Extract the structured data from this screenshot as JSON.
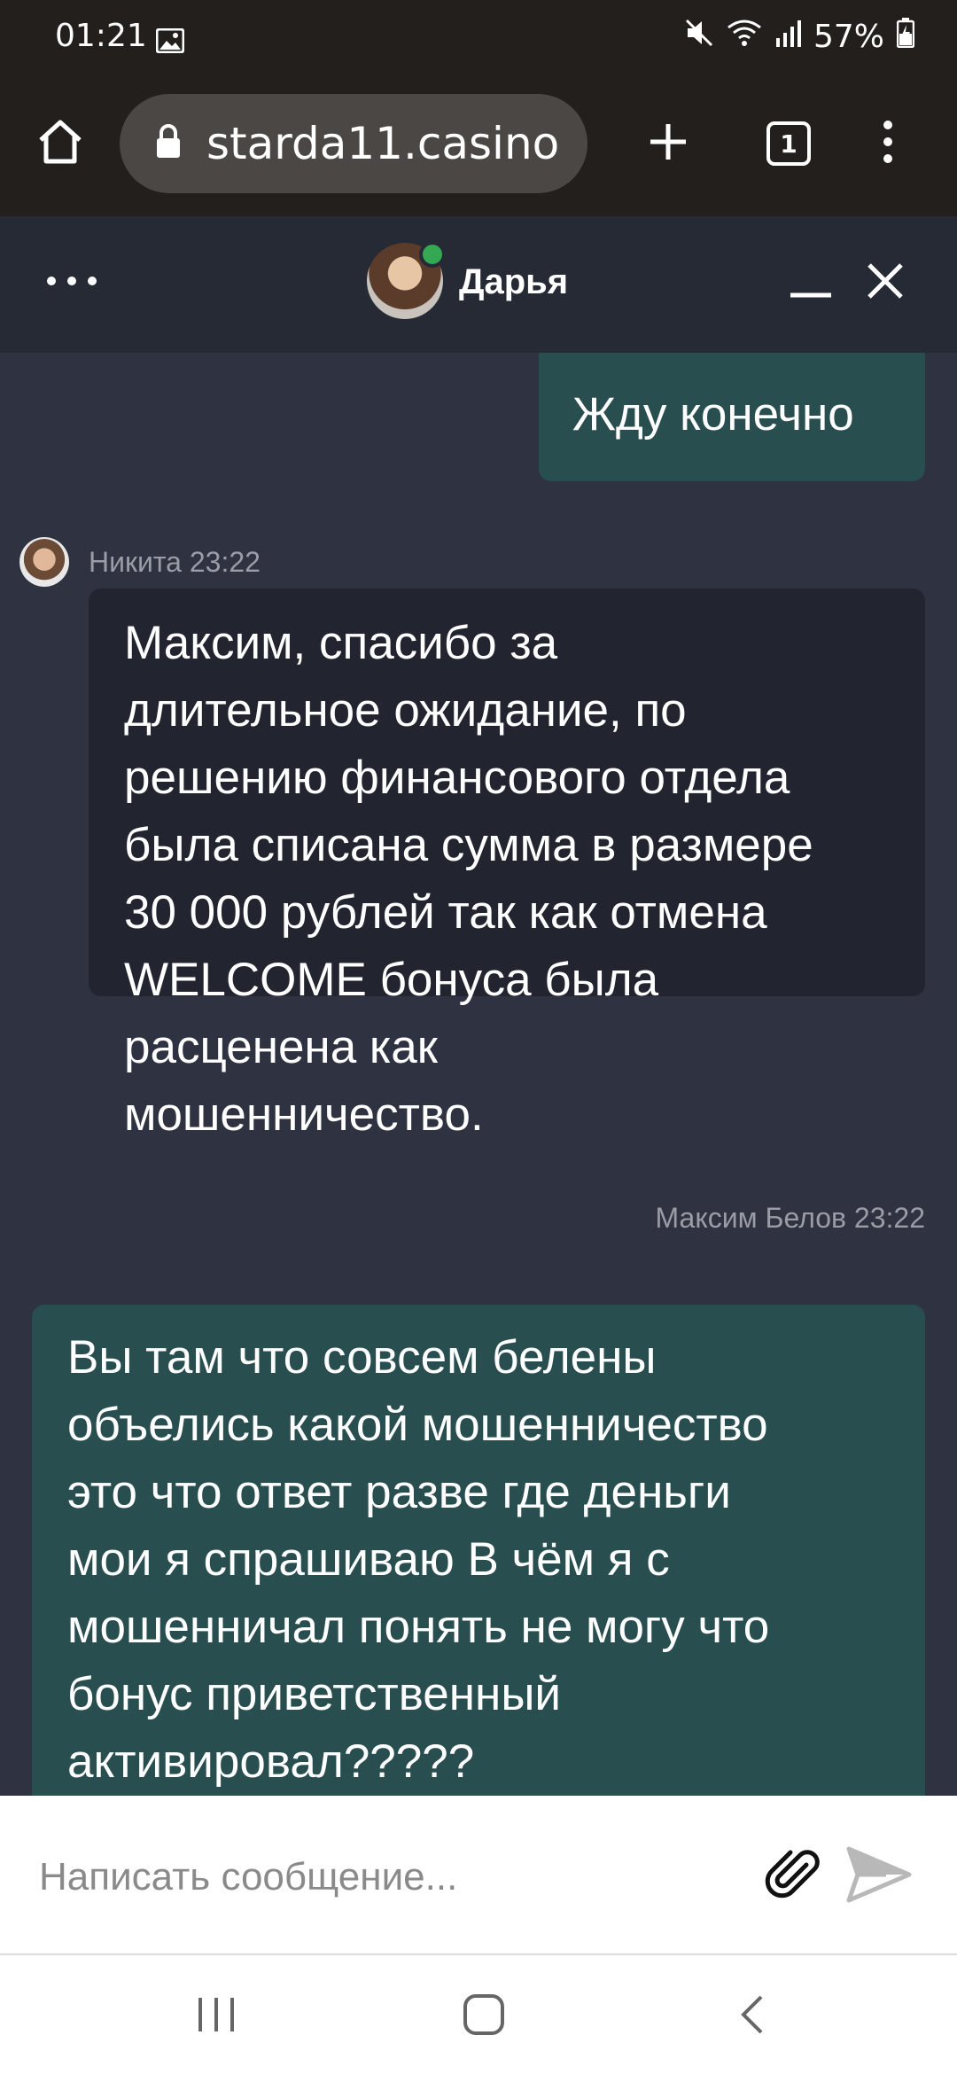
{
  "status_bar": {
    "time": "01:21",
    "battery": "57%",
    "icons": [
      "image-icon",
      "mute-icon",
      "wifi-icon",
      "signal-icon",
      "battery-icon"
    ]
  },
  "browser": {
    "url": "starda11.casino",
    "tab_count": "1",
    "icons": [
      "home-icon",
      "lock-icon",
      "new-tab-icon",
      "tabs-icon",
      "menu-icon"
    ]
  },
  "chat_header": {
    "agent_name": "Дарья",
    "status": "online",
    "icons": [
      "more-icon",
      "minimize-icon",
      "close-icon"
    ]
  },
  "messages": [
    {
      "direction": "out",
      "text": "Жду конечно"
    },
    {
      "direction": "in",
      "sender": "Никита",
      "time": "23:22",
      "meta": "Никита 23:22",
      "lines": [
        "Максим, спасибо за",
        "длительное ожидание, по",
        "решению финансового отдела",
        "была списана сумма в размере",
        "30 000 рублей так как отмена",
        "WELCOME бонуса была",
        "расценена как",
        "мошенничество."
      ]
    },
    {
      "direction": "out",
      "sender": "Максим Белов",
      "time": "23:22",
      "meta": "Максим Белов 23:22",
      "lines": [
        "Вы там что совсем белены",
        "объелись какой мошенничество",
        "это что ответ разве где деньги",
        "мои я спрашиваю В чём я с",
        "мошенничал понять не могу что",
        "бонус приветственный",
        "активировал?????"
      ]
    }
  ],
  "composer": {
    "placeholder": "Написать сообщение...",
    "icons": [
      "attach-icon",
      "send-icon"
    ]
  },
  "nav": {
    "icons": [
      "recent-apps-icon",
      "home-nav-icon",
      "back-icon"
    ]
  },
  "colors": {
    "chat_bg": "#2f3240",
    "header_bg": "#262a35",
    "outgoing_bubble": "#284e4f",
    "incoming_bubble": "#222530",
    "online": "#35a853",
    "browser_bg": "#231f1c"
  }
}
